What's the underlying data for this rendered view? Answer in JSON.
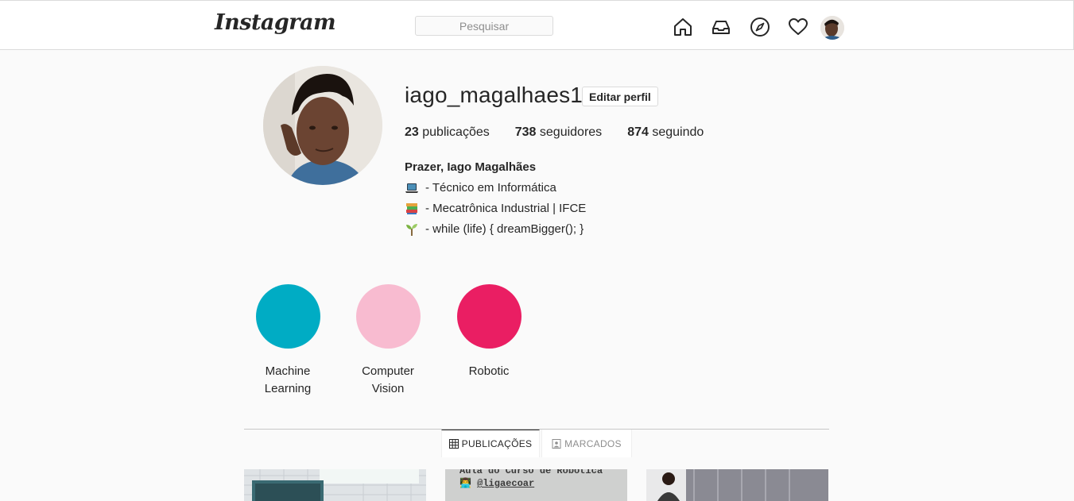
{
  "header": {
    "logo": "Instagram",
    "search_placeholder": "Pesquisar",
    "icons": [
      "home-icon",
      "inbox-icon",
      "explore-icon",
      "activity-icon",
      "avatar"
    ]
  },
  "profile": {
    "username": "iago_magalhaes11",
    "edit_label": "Editar perfil",
    "stats": [
      {
        "count": "23",
        "label": "publicações"
      },
      {
        "count": "738",
        "label": "seguidores"
      },
      {
        "count": "874",
        "label": "seguindo"
      }
    ],
    "full_name": "Prazer, Iago Magalhães",
    "bio_lines": [
      {
        "icon": "laptop-icon",
        "text": "- Técnico em Informática"
      },
      {
        "icon": "books-icon",
        "text": "- Mecatrônica Industrial | IFCE"
      },
      {
        "icon": "seedling-icon",
        "text": "- while (life) { dreamBigger(); }"
      }
    ]
  },
  "highlights": [
    {
      "label": "Machine Learning",
      "color": "#00acc4"
    },
    {
      "label": "Computer Vision",
      "color": "#f8bbd0"
    },
    {
      "label": "Robotic",
      "color": "#ea1e63"
    }
  ],
  "tabs": [
    {
      "label": "PUBLICAÇÕES",
      "icon": "grid-icon",
      "active": true
    },
    {
      "label": "MARCADOS",
      "icon": "tagged-icon",
      "active": false
    }
  ],
  "posts": [
    {
      "caption": ""
    },
    {
      "caption_line1": "Aula do Curso de Robótica",
      "caption_line2": "@ligaecoar"
    },
    {
      "caption": ""
    }
  ],
  "colors": {
    "highlight_cyan": "#00acc4",
    "highlight_pink": "#f8bbd0",
    "highlight_red": "#ea1e63"
  }
}
